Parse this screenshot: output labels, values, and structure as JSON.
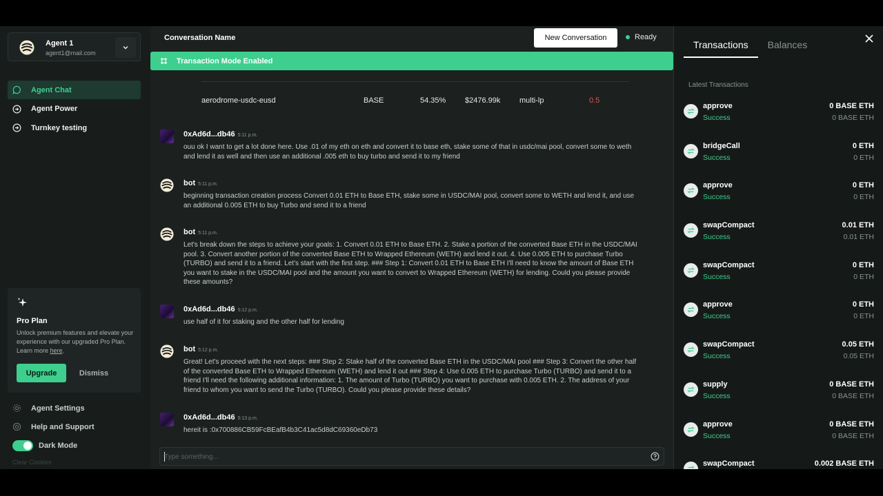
{
  "agent": {
    "name": "Agent 1",
    "email": "agent1@mail.com"
  },
  "nav": [
    {
      "label": "Agent Chat",
      "active": true
    },
    {
      "label": "Agent Power",
      "active": false
    },
    {
      "label": "Turnkey testing",
      "active": false
    }
  ],
  "pro": {
    "title": "Pro Plan",
    "desc": "Unlock premium features and elevate your experience with our upgraded Pro Plan. Learn more",
    "link": "here",
    "upgrade": "Upgrade",
    "dismiss": "Dismiss"
  },
  "bottom_nav": {
    "settings": "Agent Settings",
    "help": "Help and Support",
    "dark_mode": "Dark Mode",
    "clear": "Clear Cookies"
  },
  "header": {
    "conversation_name": "Conversation Name",
    "new_conversation": "New Conversation",
    "status": "Ready"
  },
  "banner": "Transaction Mode Enabled",
  "pool_row": {
    "name": "aerodrome-usdc-eusd",
    "chain": "BASE",
    "apy": "54.35%",
    "tvl": "$2476.99k",
    "type": "multi-lp",
    "risk": "0.5"
  },
  "messages": [
    {
      "sender": "0xAd6d...db46",
      "time": "5:11 p.m.",
      "user": true,
      "text": "ouu ok I want to get a lot done here. Use .01 of my eth on eth and convert it to base eth, stake some of that in usdc/mai pool, convert some to weth and lend it as well and then use an additional .005 eth to buy turbo and send it to my friend"
    },
    {
      "sender": "bot",
      "time": "5:11 p.m.",
      "user": false,
      "text": "beginning transaction creation process Convert 0.01 ETH to Base ETH, stake some in USDC/MAI pool, convert some to WETH and lend it, and use an additional 0.005 ETH to buy Turbo and send it to a friend"
    },
    {
      "sender": "bot",
      "time": "5:11 p.m.",
      "user": false,
      "text": "Let's break down the steps to achieve your goals: 1. Convert 0.01 ETH to Base ETH. 2. Stake a portion of the converted Base ETH in the USDC/MAI pool. 3. Convert another portion of the converted Base ETH to Wrapped Ethereum (WETH) and lend it out. 4. Use 0.005 ETH to purchase Turbo (TURBO) and send it to a friend. Let's start with the first step. ### Step 1: Convert 0.01 ETH to Base ETH I'll need to know the amount of Base ETH you want to stake in the USDC/MAI pool and the amount you want to convert to Wrapped Ethereum (WETH) for lending. Could you please provide these amounts?"
    },
    {
      "sender": "0xAd6d...db46",
      "time": "5:12 p.m.",
      "user": true,
      "text": "use half of it for staking and the other half for lending"
    },
    {
      "sender": "bot",
      "time": "5:12 p.m.",
      "user": false,
      "text": "Great! Let's proceed with the next steps: ### Step 2: Stake half of the converted Base ETH in the USDC/MAI pool ### Step 3: Convert the other half of the converted Base ETH to Wrapped Ethereum (WETH) and lend it out ### Step 4: Use 0.005 ETH to purchase Turbo (TURBO) and send it to a friend I'll need the following additional information: 1. The amount of Turbo (TURBO) you want to purchase with 0.005 ETH. 2. The address of your friend to whom you want to send the Turbo (TURBO). Could you please provide these details?"
    },
    {
      "sender": "0xAd6d...db46",
      "time": "5:13 p.m.",
      "user": true,
      "text": "hereit is :0x700886CB59FcBEafB4b3C41ac5d8dC69360eDb73"
    }
  ],
  "input": {
    "placeholder": "Type something..."
  },
  "right_panel": {
    "tabs": [
      "Transactions",
      "Balances"
    ],
    "latest_label": "Latest Transactions",
    "transactions": [
      {
        "name": "approve",
        "status": "Success",
        "amount": "0 BASE ETH",
        "amount2": "0 BASE ETH"
      },
      {
        "name": "bridgeCall",
        "status": "Success",
        "amount": "0 ETH",
        "amount2": "0 ETH"
      },
      {
        "name": "approve",
        "status": "Success",
        "amount": "0 ETH",
        "amount2": "0 ETH"
      },
      {
        "name": "swapCompact",
        "status": "Success",
        "amount": "0.01 ETH",
        "amount2": "0.01 ETH"
      },
      {
        "name": "swapCompact",
        "status": "Success",
        "amount": "0 ETH",
        "amount2": "0 ETH"
      },
      {
        "name": "approve",
        "status": "Success",
        "amount": "0 ETH",
        "amount2": "0 ETH"
      },
      {
        "name": "swapCompact",
        "status": "Success",
        "amount": "0.05 ETH",
        "amount2": "0.05 ETH"
      },
      {
        "name": "supply",
        "status": "Success",
        "amount": "0 BASE ETH",
        "amount2": "0 BASE ETH"
      },
      {
        "name": "approve",
        "status": "Success",
        "amount": "0 BASE ETH",
        "amount2": "0 BASE ETH"
      },
      {
        "name": "swapCompact",
        "status": "",
        "amount": "0.002 BASE ETH",
        "amount2": ""
      }
    ]
  },
  "colors": {
    "accent": "#3ecf8e",
    "risk": "#e0534a",
    "background": "#1c2120"
  }
}
